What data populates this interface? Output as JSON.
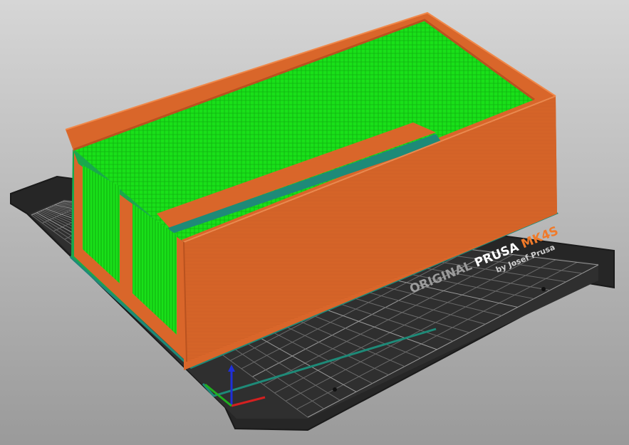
{
  "viewport": {
    "background_top": "#d6d6d6",
    "background_bottom": "#9a9a9a"
  },
  "bed": {
    "brand_prefix": "ORIGINAL",
    "brand_name": "PRUSA",
    "brand_model": "MK4S",
    "brand_tagline": "by Josef Prusa",
    "plate_color": "#2b2b2b",
    "grid_color": "#6a6a6a",
    "accent_color": "#f07a2a"
  },
  "model": {
    "perimeter_color": "#d9662a",
    "infill_color": "#19e019",
    "skirt_color": "#1e8a78"
  },
  "axes": {
    "x_icon": "x-axis-arrow",
    "y_icon": "y-axis-arrow",
    "z_icon": "z-axis-arrow"
  }
}
